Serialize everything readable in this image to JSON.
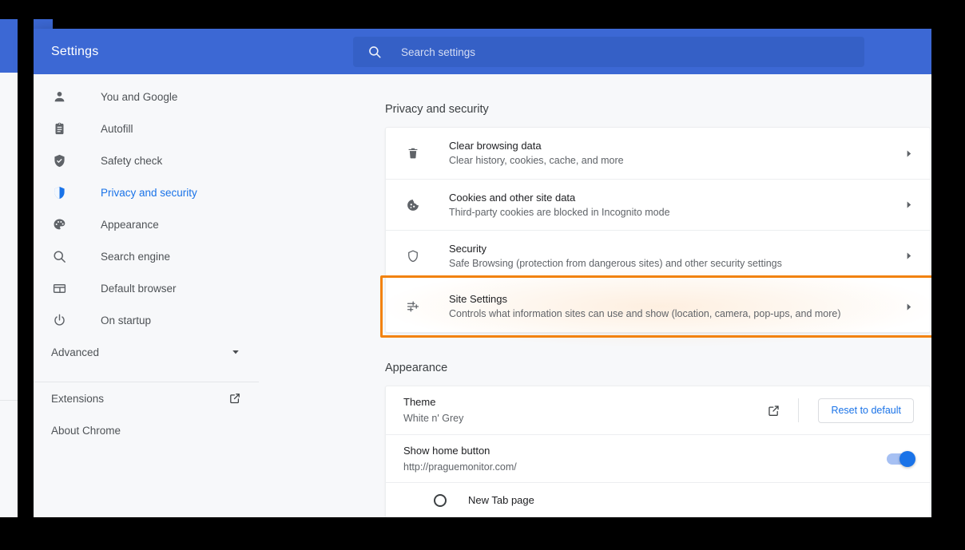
{
  "window": {
    "toolbar_title": "Settings",
    "accent_blue": "#3c68d4",
    "link_blue": "#1a73e8",
    "highlight_orange": "#f2820d"
  },
  "search": {
    "placeholder": "Search settings",
    "value": "",
    "icon": "search-icon"
  },
  "sidebar": {
    "items": [
      {
        "label": "You and Google",
        "icon": "person-icon",
        "active": false
      },
      {
        "label": "Autofill",
        "icon": "clipboard-icon",
        "active": false
      },
      {
        "label": "Safety check",
        "icon": "shield-check-icon",
        "active": false
      },
      {
        "label": "Privacy and security",
        "icon": "shield-icon",
        "active": true
      },
      {
        "label": "Appearance",
        "icon": "palette-icon",
        "active": false
      },
      {
        "label": "Search engine",
        "icon": "search-icon",
        "active": false
      },
      {
        "label": "Default browser",
        "icon": "browser-window-icon",
        "active": false
      },
      {
        "label": "On startup",
        "icon": "power-icon",
        "active": false
      }
    ],
    "advanced": {
      "label": "Advanced",
      "icon": "chevron-down-icon"
    },
    "extensions": {
      "label": "Extensions",
      "icon": "launch-external-icon"
    },
    "about": {
      "label": "About Chrome"
    }
  },
  "main": {
    "privacy": {
      "title": "Privacy and security",
      "rows": [
        {
          "title": "Clear browsing data",
          "subtitle": "Clear history, cookies, cache, and more",
          "icon": "trash-icon",
          "arrow": "chevron-right-icon",
          "highlighted": false
        },
        {
          "title": "Cookies and other site data",
          "subtitle": "Third-party cookies are blocked in Incognito mode",
          "icon": "cookie-icon",
          "arrow": "chevron-right-icon",
          "highlighted": false
        },
        {
          "title": "Security",
          "subtitle": "Safe Browsing (protection from dangerous sites) and other security settings",
          "icon": "shield-icon",
          "arrow": "chevron-right-icon",
          "highlighted": false
        },
        {
          "title": "Site Settings",
          "subtitle": "Controls what information sites can use and show (location, camera, pop-ups, and more)",
          "icon": "sliders-icon",
          "arrow": "chevron-right-icon",
          "highlighted": true
        }
      ]
    },
    "appearance": {
      "title": "Appearance",
      "theme": {
        "title": "Theme",
        "subtitle": "White n' Grey",
        "launch_icon": "launch-external-icon",
        "reset_button": "Reset to default"
      },
      "home_button": {
        "title": "Show home button",
        "subtitle": "http://praguemonitor.com/",
        "toggle_on": true
      },
      "new_tab": {
        "label": "New Tab page",
        "selected": false
      }
    }
  }
}
